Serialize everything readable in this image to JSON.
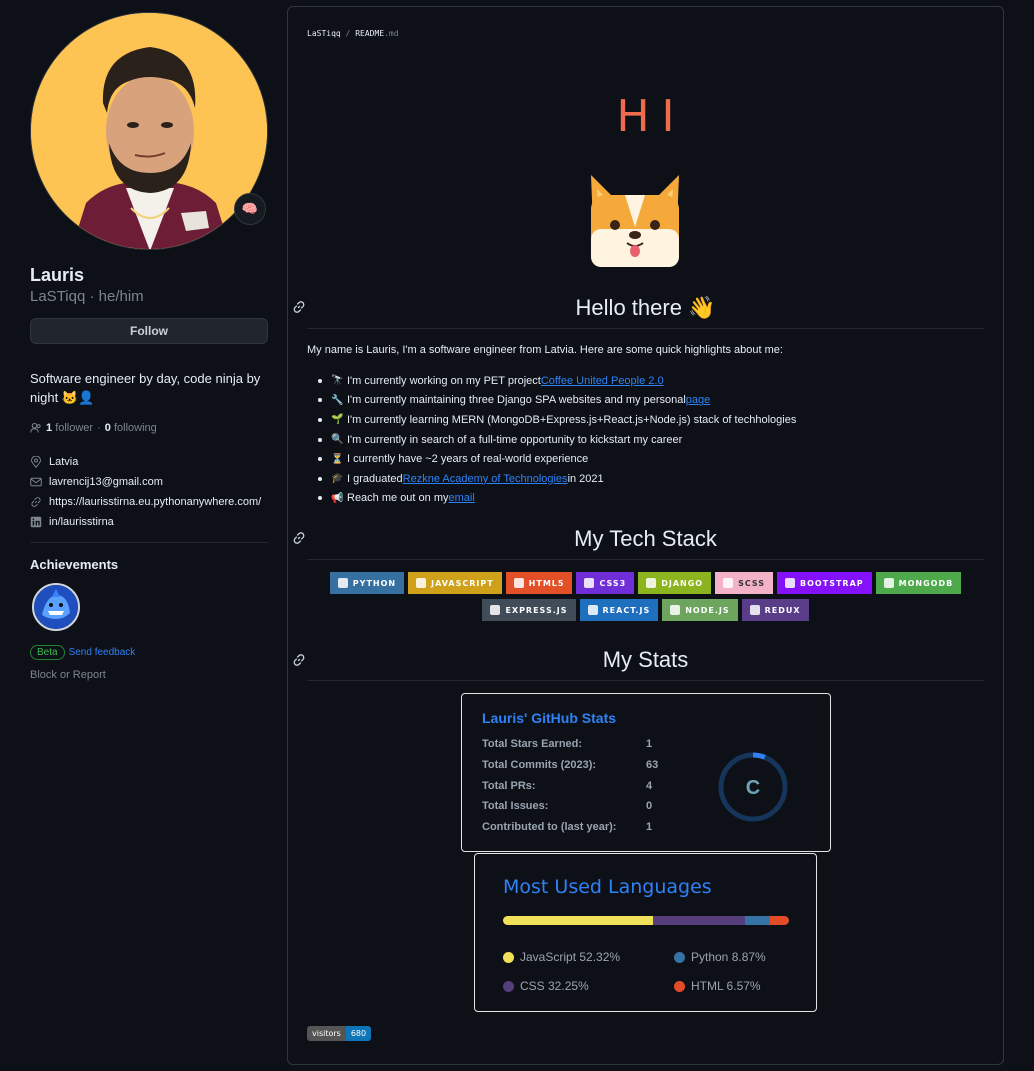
{
  "profile": {
    "name": "Lauris",
    "login_line": "LaSTiqq · he/him",
    "status_emoji": "🧠",
    "follow_label": "Follow",
    "bio": "Software engineer by day, code ninja by night 🐱‍👤",
    "followers_count": "1",
    "followers_label": "follower",
    "separator": "·",
    "following_count": "0",
    "following_label": "following",
    "location": "Latvia",
    "email": "lavrencij13@gmail.com",
    "website": "https://laurisstirna.eu.pythonanywhere.com/",
    "linkedin": "in/laurisstirna",
    "achievements_title": "Achievements",
    "beta_label": "Beta",
    "send_feedback": "Send feedback",
    "block_report": "Block or Report"
  },
  "readme": {
    "owner": "LaSTiqq",
    "sep": "/",
    "file": "README",
    "ext": ".md",
    "hi": "HI",
    "hello_heading": "Hello there 👋",
    "intro": "My name is Lauris, I'm a software engineer from Latvia. Here are some quick highlights about me:",
    "highlights": [
      {
        "emoji": "🔭",
        "pre": "I'm currently working on my PET project ",
        "link": "Coffee United People 2.0",
        "post": ""
      },
      {
        "emoji": "🔧",
        "pre": "I'm currently maintaining three Django SPA websites and my personal ",
        "link": "page",
        "post": ""
      },
      {
        "emoji": "🌱",
        "pre": "I'm currently learning MERN (MongoDB+Express.js+React.js+Node.js) stack of techhologies",
        "link": "",
        "post": ""
      },
      {
        "emoji": "🔍",
        "pre": "I'm currently in search of a full-time opportunity to kickstart my career",
        "link": "",
        "post": ""
      },
      {
        "emoji": "⏳",
        "pre": "I currently have ~2 years of real-world experience",
        "link": "",
        "post": ""
      },
      {
        "emoji": "🎓",
        "pre": "I graduated ",
        "link": "Rezkne Academy of Technologies",
        "post": " in 2021"
      },
      {
        "emoji": "📢",
        "pre": "Reach me out on my ",
        "link": "email",
        "post": ""
      }
    ],
    "tech_heading": "My Tech Stack",
    "tech_row1": [
      {
        "label": "PYTHON",
        "color": "#3670a0"
      },
      {
        "label": "JAVASCRIPT",
        "color": "#cfa11a"
      },
      {
        "label": "HTML5",
        "color": "#e34f26"
      },
      {
        "label": "CSS3",
        "color": "#6f2ed6"
      },
      {
        "label": "DJANGO",
        "color": "#8bb41e"
      },
      {
        "label": "SCSS",
        "color": "#f3b2c8"
      },
      {
        "label": "BOOTSTRAP",
        "color": "#8511fa"
      },
      {
        "label": "MONGODB",
        "color": "#4ea94b"
      }
    ],
    "tech_row2": [
      {
        "label": "EXPRESS.JS",
        "color": "#404d59"
      },
      {
        "label": "REACT.JS",
        "color": "#1f6fbf"
      },
      {
        "label": "NODE.JS",
        "color": "#6da55f"
      },
      {
        "label": "REDUX",
        "color": "#593d88"
      }
    ],
    "stats_heading": "My Stats",
    "stats": {
      "title": "Lauris' GitHub Stats",
      "rows": [
        {
          "label": "Total Stars Earned:",
          "value": "1"
        },
        {
          "label": "Total Commits (2023):",
          "value": "63"
        },
        {
          "label": "Total PRs:",
          "value": "4"
        },
        {
          "label": "Total Issues:",
          "value": "0"
        },
        {
          "label": "Contributed to (last year):",
          "value": "1"
        }
      ],
      "rank": "C",
      "rank_progress": 0.06
    },
    "languages": {
      "title": "Most Used Languages",
      "items": [
        {
          "name": "JavaScript",
          "percent": 52.32,
          "label": "JavaScript 52.32%",
          "color": "#f1e05a"
        },
        {
          "name": "CSS",
          "percent": 32.25,
          "label": "CSS 32.25%",
          "color": "#563d7c"
        },
        {
          "name": "Python",
          "percent": 8.87,
          "label": "Python 8.87%",
          "color": "#3572A5"
        },
        {
          "name": "HTML",
          "percent": 6.57,
          "label": "HTML 6.57%",
          "color": "#e34c26"
        }
      ]
    },
    "visitors_label": "visitors",
    "visitors_count": "680"
  }
}
